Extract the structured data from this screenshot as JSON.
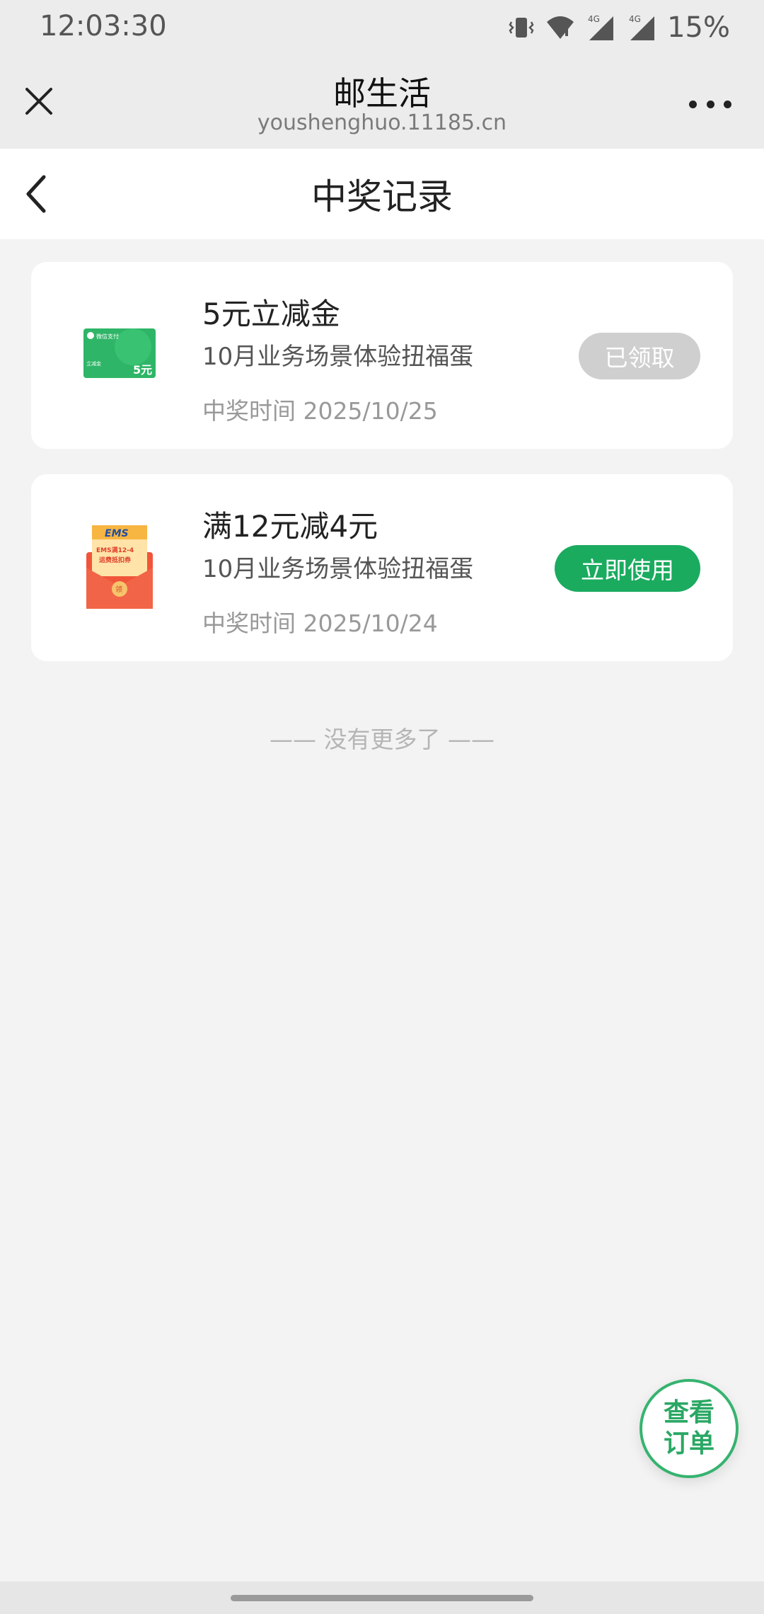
{
  "status_bar": {
    "time": "12:03:30",
    "network_1": "4G",
    "network_2": "4G",
    "battery": "15%"
  },
  "miniprogram": {
    "title": "邮生活",
    "url": "youshenghuo.11185.cn"
  },
  "page": {
    "title": "中奖记录"
  },
  "records": [
    {
      "name": "5元立减金",
      "activity": "10月业务场景体验扭福蛋",
      "won_time": "中奖时间 2025/10/25",
      "action": "已领取",
      "thumb_pay_text": "微信支付",
      "thumb_type_text": "立减金",
      "thumb_amount": "5元",
      "thumb_color": "#2fb567"
    },
    {
      "name": "满12元减4元",
      "activity": "10月业务场景体验扭福蛋",
      "won_time": "中奖时间 2025/10/24",
      "action": "立即使用",
      "thumb_brand": "EMS",
      "thumb_line1": "EMS满12-4",
      "thumb_line2": "运费抵扣券",
      "thumb_seal": "领",
      "thumb_color": "#f0553a"
    }
  ],
  "no_more": "—— 没有更多了 ——",
  "fab": {
    "label": "查看订单"
  },
  "colors": {
    "accent_green": "#1aab5f",
    "claimed_grey": "#cfcfcf",
    "background": "#f3f3f3"
  }
}
